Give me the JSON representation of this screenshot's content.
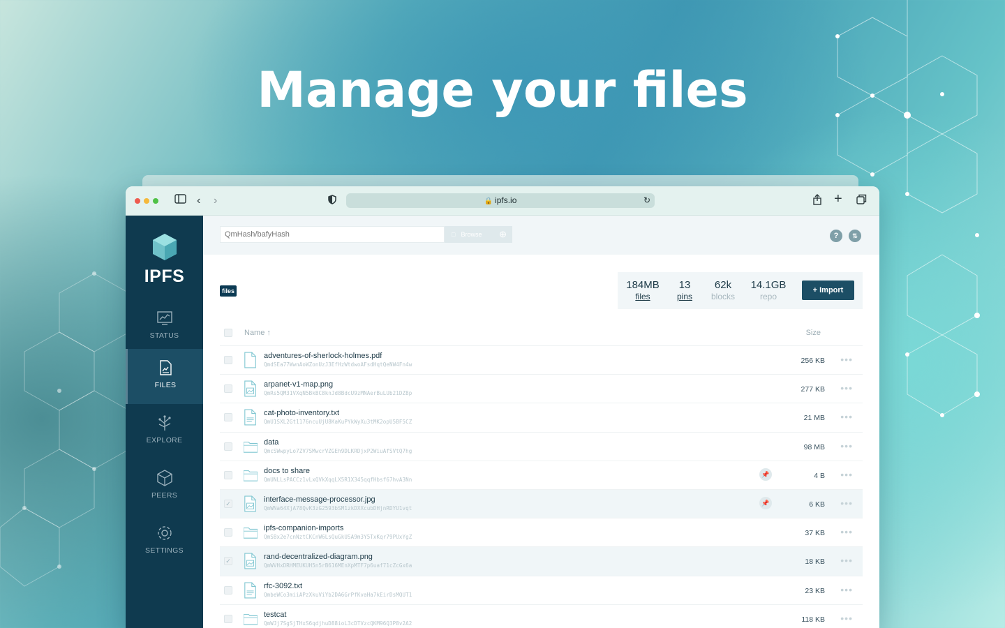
{
  "hero": {
    "headline": "Manage your files"
  },
  "browser": {
    "url": "ipfs.io"
  },
  "app": {
    "logo_text": "IPFS",
    "nav": [
      {
        "label": "STATUS",
        "icon": "status-icon",
        "active": false
      },
      {
        "label": "FILES",
        "icon": "files-icon",
        "active": true
      },
      {
        "label": "EXPLORE",
        "icon": "explore-icon",
        "active": false
      },
      {
        "label": "PEERS",
        "icon": "peers-icon",
        "active": false
      },
      {
        "label": "SETTINGS",
        "icon": "settings-icon",
        "active": false
      }
    ],
    "search": {
      "placeholder": "QmHash/bafyHash",
      "browse_label": "Browse"
    },
    "breadcrumb": "files",
    "stats": [
      {
        "value": "184MB",
        "label": "files"
      },
      {
        "value": "13",
        "label": "pins"
      },
      {
        "value": "62k",
        "label": "blocks"
      },
      {
        "value": "14.1GB",
        "label": "repo"
      }
    ],
    "import_label": "+ Import",
    "table": {
      "col_name": "Name ↑",
      "col_size": "Size",
      "rows": [
        {
          "name": "adventures-of-sherlock-holmes.pdf",
          "hash": "QmdSEa77WwnAoWZonUzJ3EfHzWtdwoAFsdHqtQeNW4Fn4w",
          "size": "256 KB",
          "type": "doc",
          "pinned": false,
          "selected": false
        },
        {
          "name": "arpanet-v1-map.png",
          "hash": "QmRs5QM31VXqN5BkBC8knJd8BdcU9zMNAerBuLUb21DZ8p",
          "size": "277 KB",
          "type": "image",
          "pinned": false,
          "selected": false
        },
        {
          "name": "cat-photo-inventory.txt",
          "hash": "QmU1SXL2Gt1176ncuUjU8KaKuPYkWyXu3tMK2opU5BF5CZ",
          "size": "21 MB",
          "type": "text",
          "pinned": false,
          "selected": false
        },
        {
          "name": "data",
          "hash": "QmcSWwpyLo7ZV7SMwcrVZGEh9DLKRDjxP2WiuAfSVtQ7hg",
          "size": "98 MB",
          "type": "folder",
          "pinned": false,
          "selected": false
        },
        {
          "name": "docs to share",
          "hash": "QmUNLLsPACCz1vLxQVkXqqLX5R1X345qqfHbsf67hvA3Nn",
          "size": "4 B",
          "type": "folder",
          "pinned": true,
          "selected": false
        },
        {
          "name": "interface-message-processor.jpg",
          "hash": "QmWNa64XjA78QvK3zG2593bSM1zkDXXcubDHjnRDYU1vqt",
          "size": "6 KB",
          "type": "image",
          "pinned": true,
          "selected": true
        },
        {
          "name": "ipfs-companion-imports",
          "hash": "QmSBx2e7cnNztCKCnW6LsQuGkUSA9m3Y5TxKqr79PUxYgZ",
          "size": "37 KB",
          "type": "folder",
          "pinned": false,
          "selected": false
        },
        {
          "name": "rand-decentralized-diagram.png",
          "hash": "QmWVHxDRHMEUKUH5n5rB616MEnXpMTF7p6uaf71cZcGx6a",
          "size": "18 KB",
          "type": "image",
          "pinned": false,
          "selected": true
        },
        {
          "name": "rfc-3092.txt",
          "hash": "QmbeWCo3miiAPzXkuViYb2DA6GrPfKvaHa7kEirDsMQUT1",
          "size": "23 KB",
          "type": "text",
          "pinned": false,
          "selected": false
        },
        {
          "name": "testcat",
          "hash": "QmWJj7SgSjTHxS6qdjhuD88ioL3cDTVzcQKM96Q3P8v2A2",
          "size": "118 KB",
          "type": "folder",
          "pinned": false,
          "selected": false
        }
      ]
    }
  }
}
